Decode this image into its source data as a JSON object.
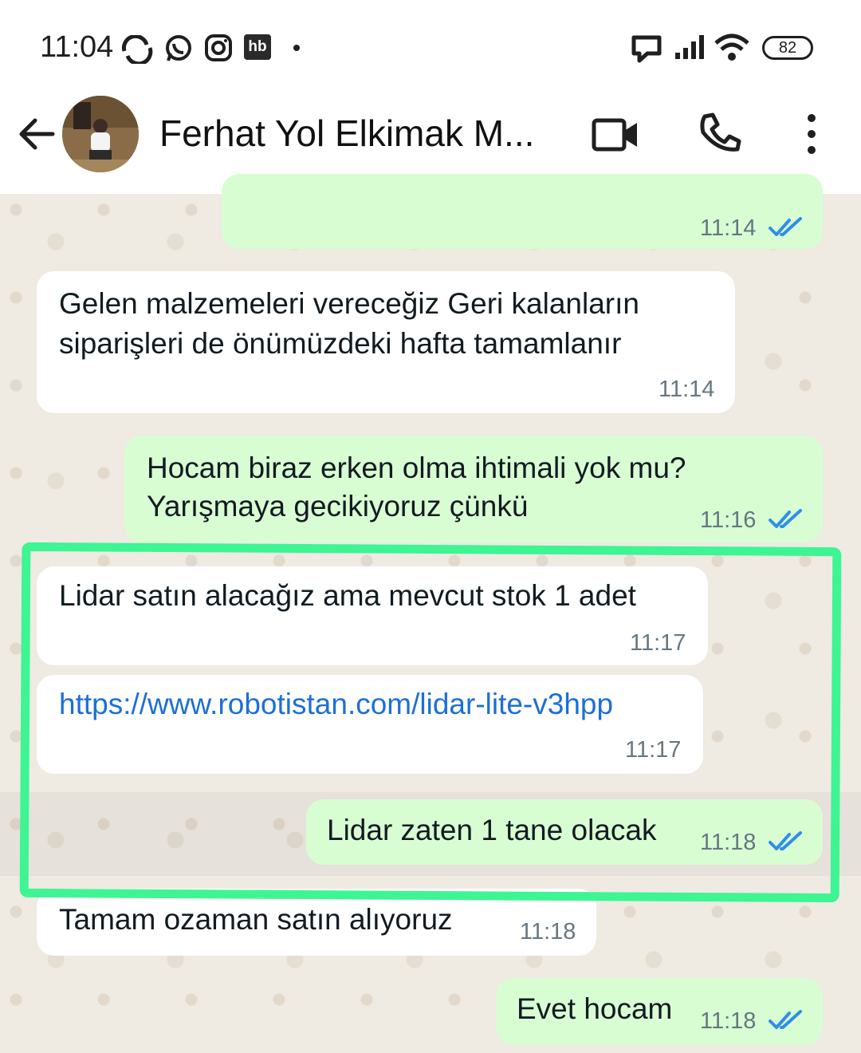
{
  "status_bar": {
    "time": "11:04",
    "battery": "82",
    "left_icons": [
      "cloud-sync-icon",
      "whatsapp-icon",
      "instagram-icon",
      "hb-app-icon",
      "dot-icon"
    ],
    "hb_label": "hb",
    "right_icons": [
      "chat-icon",
      "signal-icon",
      "wifi-icon",
      "battery-icon"
    ]
  },
  "header": {
    "contact_name": "Ferhat Yol Elkimak M...",
    "icons": [
      "back-arrow-icon",
      "video-call-icon",
      "phone-call-icon",
      "more-vert-icon"
    ]
  },
  "messages": [
    {
      "direction": "out",
      "text": "",
      "time": "11:14",
      "read": true
    },
    {
      "direction": "in",
      "text_lines": [
        "Gelen malzemeleri vereceğiz Geri kalanların",
        "siparişleri de önümüzdeki hafta tamamlanır"
      ],
      "time": "11:14"
    },
    {
      "direction": "out",
      "text_lines": [
        "Hocam biraz erken olma ihtimali yok mu?",
        "Yarışmaya gecikiyoruz çünkü"
      ],
      "time": "11:16",
      "read": true
    },
    {
      "direction": "in",
      "text": "Lidar satın alacağız ama mevcut stok 1 adet",
      "time": "11:17"
    },
    {
      "direction": "in",
      "text": "https://www.robotistan.com/lidar-lite-v3hpp",
      "time": "11:17",
      "is_link": true
    },
    {
      "direction": "out",
      "text": "Lidar zaten 1 tane olacak",
      "time": "11:18",
      "read": true
    },
    {
      "direction": "in",
      "text": "Tamam ozaman satın alıyoruz",
      "time": "11:18"
    },
    {
      "direction": "out",
      "text": "Evet hocam",
      "time": "11:18",
      "read": true
    }
  ],
  "colors": {
    "incoming_bubble": "#ffffff",
    "outgoing_bubble": "#d9fdd3",
    "read_ticks": "#2f8fe8",
    "link": "#1d6fd6",
    "highlight_annotation": "#3df593",
    "chat_background": "#efeae2"
  }
}
